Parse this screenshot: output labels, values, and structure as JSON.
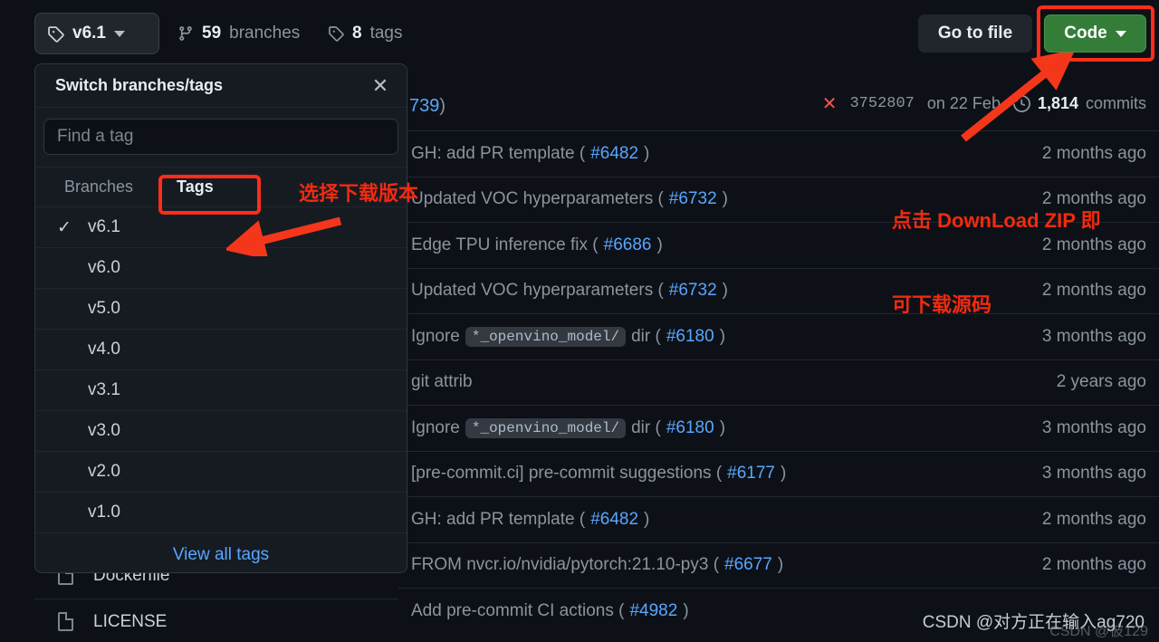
{
  "header": {
    "branch_selector": {
      "label": "v6.1",
      "icon": "tag-icon",
      "caret": "chevron-down-icon"
    },
    "branches": {
      "count": "59",
      "noun": "branches",
      "icon": "branch-icon"
    },
    "tags": {
      "count": "8",
      "noun": "tags",
      "icon": "tag-icon"
    },
    "go_to_file": "Go to file",
    "code_button": "Code"
  },
  "commit_bar": {
    "message_tail": "739",
    "paren_close": ")",
    "status_icon": "x-fail-icon",
    "sha": "3752807",
    "date": "on 22 Feb",
    "history_icon": "history-icon",
    "commits_count": "1,814",
    "commits_label": "commits"
  },
  "commits": [
    {
      "prefix": "GH: add PR template (",
      "code": "",
      "mid": "",
      "issue": "#6482",
      "suffix": ")",
      "age": "2 months ago"
    },
    {
      "prefix": "Updated VOC hyperparameters (",
      "code": "",
      "mid": "",
      "issue": "#6732",
      "suffix": ")",
      "age": "2 months ago"
    },
    {
      "prefix": "Edge TPU inference fix (",
      "code": "",
      "mid": "",
      "issue": "#6686",
      "suffix": ")",
      "age": "2 months ago"
    },
    {
      "prefix": "Updated VOC hyperparameters (",
      "code": "",
      "mid": "",
      "issue": "#6732",
      "suffix": ")",
      "age": "2 months ago"
    },
    {
      "prefix": "Ignore",
      "code": "*_openvino_model/",
      "mid": "dir (",
      "issue": "#6180",
      "suffix": ")",
      "age": "3 months ago"
    },
    {
      "prefix": "git attrib",
      "code": "",
      "mid": "",
      "issue": "",
      "suffix": "",
      "age": "2 years ago"
    },
    {
      "prefix": "Ignore",
      "code": "*_openvino_model/",
      "mid": "dir (",
      "issue": "#6180",
      "suffix": ")",
      "age": "3 months ago"
    },
    {
      "prefix": "[pre-commit.ci] pre-commit suggestions (",
      "code": "",
      "mid": "",
      "issue": "#6177",
      "suffix": ")",
      "age": "3 months ago"
    },
    {
      "prefix": "GH: add PR template (",
      "code": "",
      "mid": "",
      "issue": "#6482",
      "suffix": ")",
      "age": "2 months ago"
    },
    {
      "prefix": "FROM nvcr.io/nvidia/pytorch:21.10-py3 (",
      "code": "",
      "mid": "",
      "issue": "#6677",
      "suffix": ")",
      "age": "2 months ago"
    },
    {
      "prefix": "Add pre-commit CI actions (",
      "code": "",
      "mid": "",
      "issue": "#4982",
      "suffix": ")",
      "age": ""
    }
  ],
  "files": [
    {
      "name": "Dockerfile",
      "icon": "file-icon"
    },
    {
      "name": "LICENSE",
      "icon": "file-icon"
    }
  ],
  "dropdown": {
    "title": "Switch branches/tags",
    "close_icon": "close-icon",
    "search_placeholder": "Find a tag",
    "search_value": "",
    "tabs": [
      {
        "label": "Branches",
        "active": false
      },
      {
        "label": "Tags",
        "active": true
      }
    ],
    "tags": [
      {
        "name": "v6.1",
        "selected": true,
        "check": "✓"
      },
      {
        "name": "v6.0",
        "selected": false,
        "check": ""
      },
      {
        "name": "v5.0",
        "selected": false,
        "check": ""
      },
      {
        "name": "v4.0",
        "selected": false,
        "check": ""
      },
      {
        "name": "v3.1",
        "selected": false,
        "check": ""
      },
      {
        "name": "v3.0",
        "selected": false,
        "check": ""
      },
      {
        "name": "v2.0",
        "selected": false,
        "check": ""
      },
      {
        "name": "v1.0",
        "selected": false,
        "check": ""
      }
    ],
    "view_all": "View all tags"
  },
  "annotations": {
    "select_version": "选择下载版本",
    "download_zip_line1": "点击 DownLoad ZIP 即",
    "download_zip_line2": "可下载源码",
    "highlight_color": "#ff2d1a"
  },
  "watermark": {
    "main": "CSDN @对方正在输入ag720",
    "faint": "CSDN @彼129"
  }
}
